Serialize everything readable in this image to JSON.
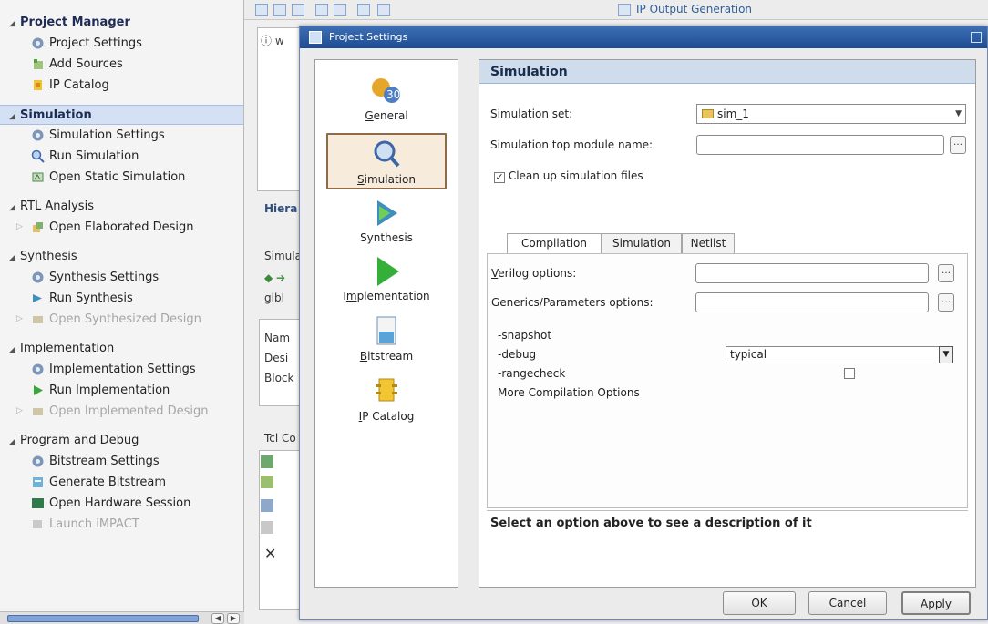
{
  "navigator": {
    "sections": [
      {
        "label": "Project Manager",
        "items": [
          {
            "label": "Project Settings",
            "icon": "gear-icon"
          },
          {
            "label": "Add Sources",
            "icon": "add-sources-icon"
          },
          {
            "label": "IP Catalog",
            "icon": "ip-catalog-icon"
          }
        ]
      },
      {
        "label": "Simulation",
        "items": [
          {
            "label": "Simulation Settings",
            "icon": "gear-icon"
          },
          {
            "label": "Run Simulation",
            "icon": "magnifier-icon"
          },
          {
            "label": "Open Static Simulation",
            "icon": "static-sim-icon"
          }
        ]
      },
      {
        "label": "RTL Analysis",
        "items": [
          {
            "label": "Open Elaborated Design",
            "icon": "elaborated-icon"
          }
        ]
      },
      {
        "label": "Synthesis",
        "items": [
          {
            "label": "Synthesis Settings",
            "icon": "gear-icon"
          },
          {
            "label": "Run Synthesis",
            "icon": "run-synthesis-icon"
          },
          {
            "label": "Open Synthesized Design",
            "icon": "design-icon"
          }
        ]
      },
      {
        "label": "Implementation",
        "items": [
          {
            "label": "Implementation Settings",
            "icon": "gear-icon"
          },
          {
            "label": "Run Implementation",
            "icon": "play-icon"
          },
          {
            "label": "Open Implemented Design",
            "icon": "design-icon"
          }
        ]
      },
      {
        "label": "Program and Debug",
        "items": [
          {
            "label": "Bitstream Settings",
            "icon": "gear-icon"
          },
          {
            "label": "Generate Bitstream",
            "icon": "bitstream-icon"
          },
          {
            "label": "Open Hardware Session",
            "icon": "hardware-icon"
          },
          {
            "label": "Launch iMPACT",
            "icon": "impact-icon"
          }
        ]
      }
    ]
  },
  "background": {
    "ip_output": "IP Output Generation",
    "hierarchy": "Hiera",
    "simul": "Simula",
    "glbl": "glbl",
    "name": "Nam",
    "design": "Desi",
    "block": "Block",
    "tcl": "Tcl Co"
  },
  "dialog": {
    "title": "Project Settings",
    "categories": [
      {
        "label": "General",
        "mnemonic": "G",
        "icon": "general-icon"
      },
      {
        "label": "Simulation",
        "mnemonic": "S",
        "icon": "simulation-magnifier-icon"
      },
      {
        "label": "Synthesis",
        "mnemonic": "",
        "icon": "synthesis-icon"
      },
      {
        "label": "Implementation",
        "mnemonic": "m",
        "icon": "implementation-icon"
      },
      {
        "label": "Bitstream",
        "mnemonic": "B",
        "icon": "bitstream-icon"
      },
      {
        "label": "IP Catalog",
        "mnemonic": "I",
        "icon": "ip-catalog-icon"
      }
    ],
    "panel": {
      "header": "Simulation",
      "sim_set_label": "Simulation set:",
      "sim_set_value": "sim_1",
      "top_module_label": "Simulation top module name:",
      "top_module_value": "",
      "cleanup_label": "Clean up simulation files",
      "cleanup_checked": true,
      "tabs": [
        "Compilation",
        "Simulation",
        "Netlist"
      ],
      "active_tab": "Compilation",
      "verilog_label": "Verilog options:",
      "generics_label": "Generics/Parameters options:",
      "options": [
        {
          "name": "-snapshot",
          "value": ""
        },
        {
          "name": "-debug",
          "value": "typical"
        },
        {
          "name": "-rangecheck",
          "value": ""
        },
        {
          "name": "More Compilation Options",
          "value": ""
        }
      ],
      "description": "Select an option above to see a description of it"
    },
    "buttons": {
      "ok": "OK",
      "cancel": "Cancel",
      "apply": "Apply"
    }
  }
}
